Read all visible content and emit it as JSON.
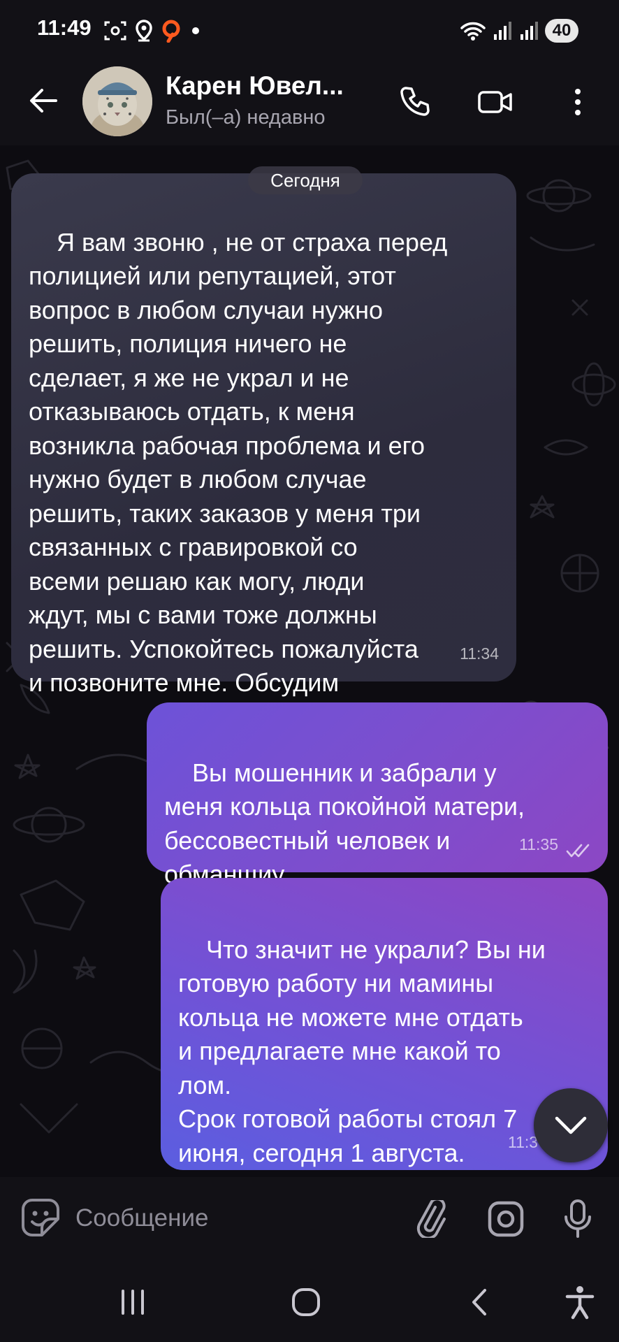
{
  "status_bar": {
    "time": "11:49",
    "battery": "40",
    "left_icons": [
      "screenshot-icon",
      "location-icon",
      "app-notification-icon",
      "dot-icon"
    ],
    "right_icons": [
      "wifi-icon",
      "signal-icon",
      "signal-icon"
    ]
  },
  "header": {
    "contact_name": "Карен Ювел...",
    "contact_status": "Был(–а) недавно",
    "back_icon": "arrow-left-icon",
    "call_icon": "phone-icon",
    "video_icon": "video-camera-icon",
    "menu_icon": "more-vertical-icon"
  },
  "chat": {
    "date_separator": "Сегодня",
    "messages": [
      {
        "direction": "incoming",
        "text": "Я вам звоню , не от страха перед\nполицией или репутацией, этот\nвопрос в любом случаи нужно\nрешить, полиция ничего не\nсделает, я же не украл и не\nотказываюсь отдать, к меня\nвозникла рабочая проблема и его\nнужно будет в любом случае\nрешить, таких заказов у меня три\nсвязанных с гравировкой со\nвсеми решаю как могу, люди\nждут, мы с вами тоже должны\nрешить. Успокойтесь пожалуйста\nи позвоните мне. Обсудим",
        "time": "11:34"
      },
      {
        "direction": "outgoing",
        "text": "Вы мошенник и забрали у\nменя кольца покойной матери,\nбессовестный человек и\nобманщиу",
        "time": "11:35",
        "status": "read"
      },
      {
        "direction": "outgoing",
        "text": "Что значит не украли? Вы ни\nготовую работу ни мамины\nкольца не можете мне отдать\nи предлагаете мне какой то\nлом.\nСрок готовой работы стоял 7\nиюня, сегодня 1 августа.",
        "time": "11:3"
      }
    ]
  },
  "composer": {
    "placeholder": "Сообщение",
    "value": "",
    "emoji_icon": "sticker-emoji-icon",
    "attach_icon": "paperclip-icon",
    "camera_icon": "camera-icon",
    "mic_icon": "microphone-icon"
  },
  "scroll_down_icon": "chevron-down-icon",
  "nav_bar": {
    "recents_icon": "recents-icon",
    "home_icon": "home-icon",
    "back_icon": "nav-back-icon",
    "accessibility_icon": "accessibility-icon"
  },
  "colors": {
    "background": "#0d0c11",
    "bar": "#121116",
    "incoming_bubble": "#34334a",
    "outgoing_bubble_start": "#6d52d8",
    "outgoing_bubble_end": "#8c47c4",
    "muted_text": "#a8a6b0"
  }
}
